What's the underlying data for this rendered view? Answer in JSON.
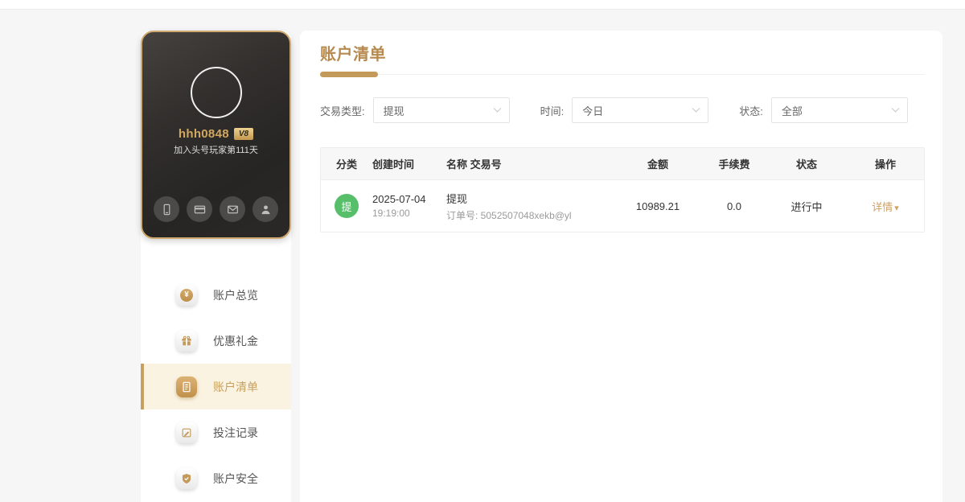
{
  "colors": {
    "accent_gold": "#c49a5b",
    "active_item_bg": "#fbf3e2",
    "card_border": "#cfa96f",
    "green_badge": "#57be6a",
    "link_gold": "#cfa263"
  },
  "profile_card": {
    "username": "hhh0848",
    "vip_badge": "V8",
    "joined_text": "加入头号玩家第111天"
  },
  "sidebar": {
    "items": [
      {
        "label": "账户总览"
      },
      {
        "label": "优惠礼金"
      },
      {
        "label": "账户清单"
      },
      {
        "label": "投注记录"
      },
      {
        "label": "账户安全"
      }
    ]
  },
  "main": {
    "title": "账户清单",
    "filters": [
      {
        "label": "交易类型:",
        "value": "提现"
      },
      {
        "label": "时间:",
        "value": "今日"
      },
      {
        "label": "状态:",
        "value": "全部"
      }
    ],
    "table": {
      "headers": [
        "分类",
        "创建时间",
        "名称 交易号",
        "金额",
        "手续费",
        "状态",
        "操作"
      ],
      "rows": [
        {
          "category_badge": "提",
          "date": "2025-07-04",
          "time": "19:19:00",
          "name": "提现",
          "order": "订单号: 5052507048xekb@yl",
          "amount": "10989.21",
          "fee": "0.0",
          "status": "进行中",
          "action": "详情"
        }
      ]
    }
  },
  "icons": {
    "yen": "¥",
    "caret_down": "▾"
  }
}
